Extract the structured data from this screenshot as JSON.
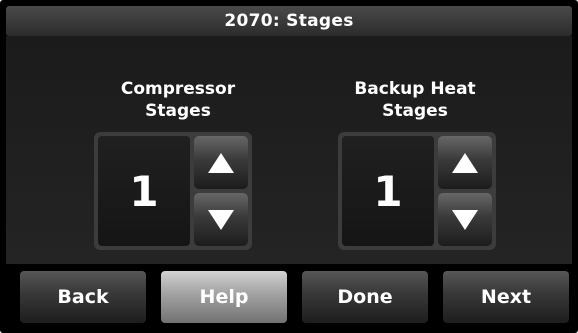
{
  "screen": {
    "title": "2070: Stages"
  },
  "compressor": {
    "label_line1": "Compressor",
    "label_line2": "Stages",
    "value": "1"
  },
  "backup_heat": {
    "label_line1": "Backup Heat",
    "label_line2": "Stages",
    "value": "1"
  },
  "icons": {
    "up": "triangle-up-icon",
    "down": "triangle-down-icon"
  },
  "buttons": {
    "back": "Back",
    "help": "Help",
    "done": "Done",
    "next": "Next"
  },
  "colors": {
    "background": "#000000",
    "text": "#ffffff",
    "help_button_highlight": "#a6a6a6"
  }
}
